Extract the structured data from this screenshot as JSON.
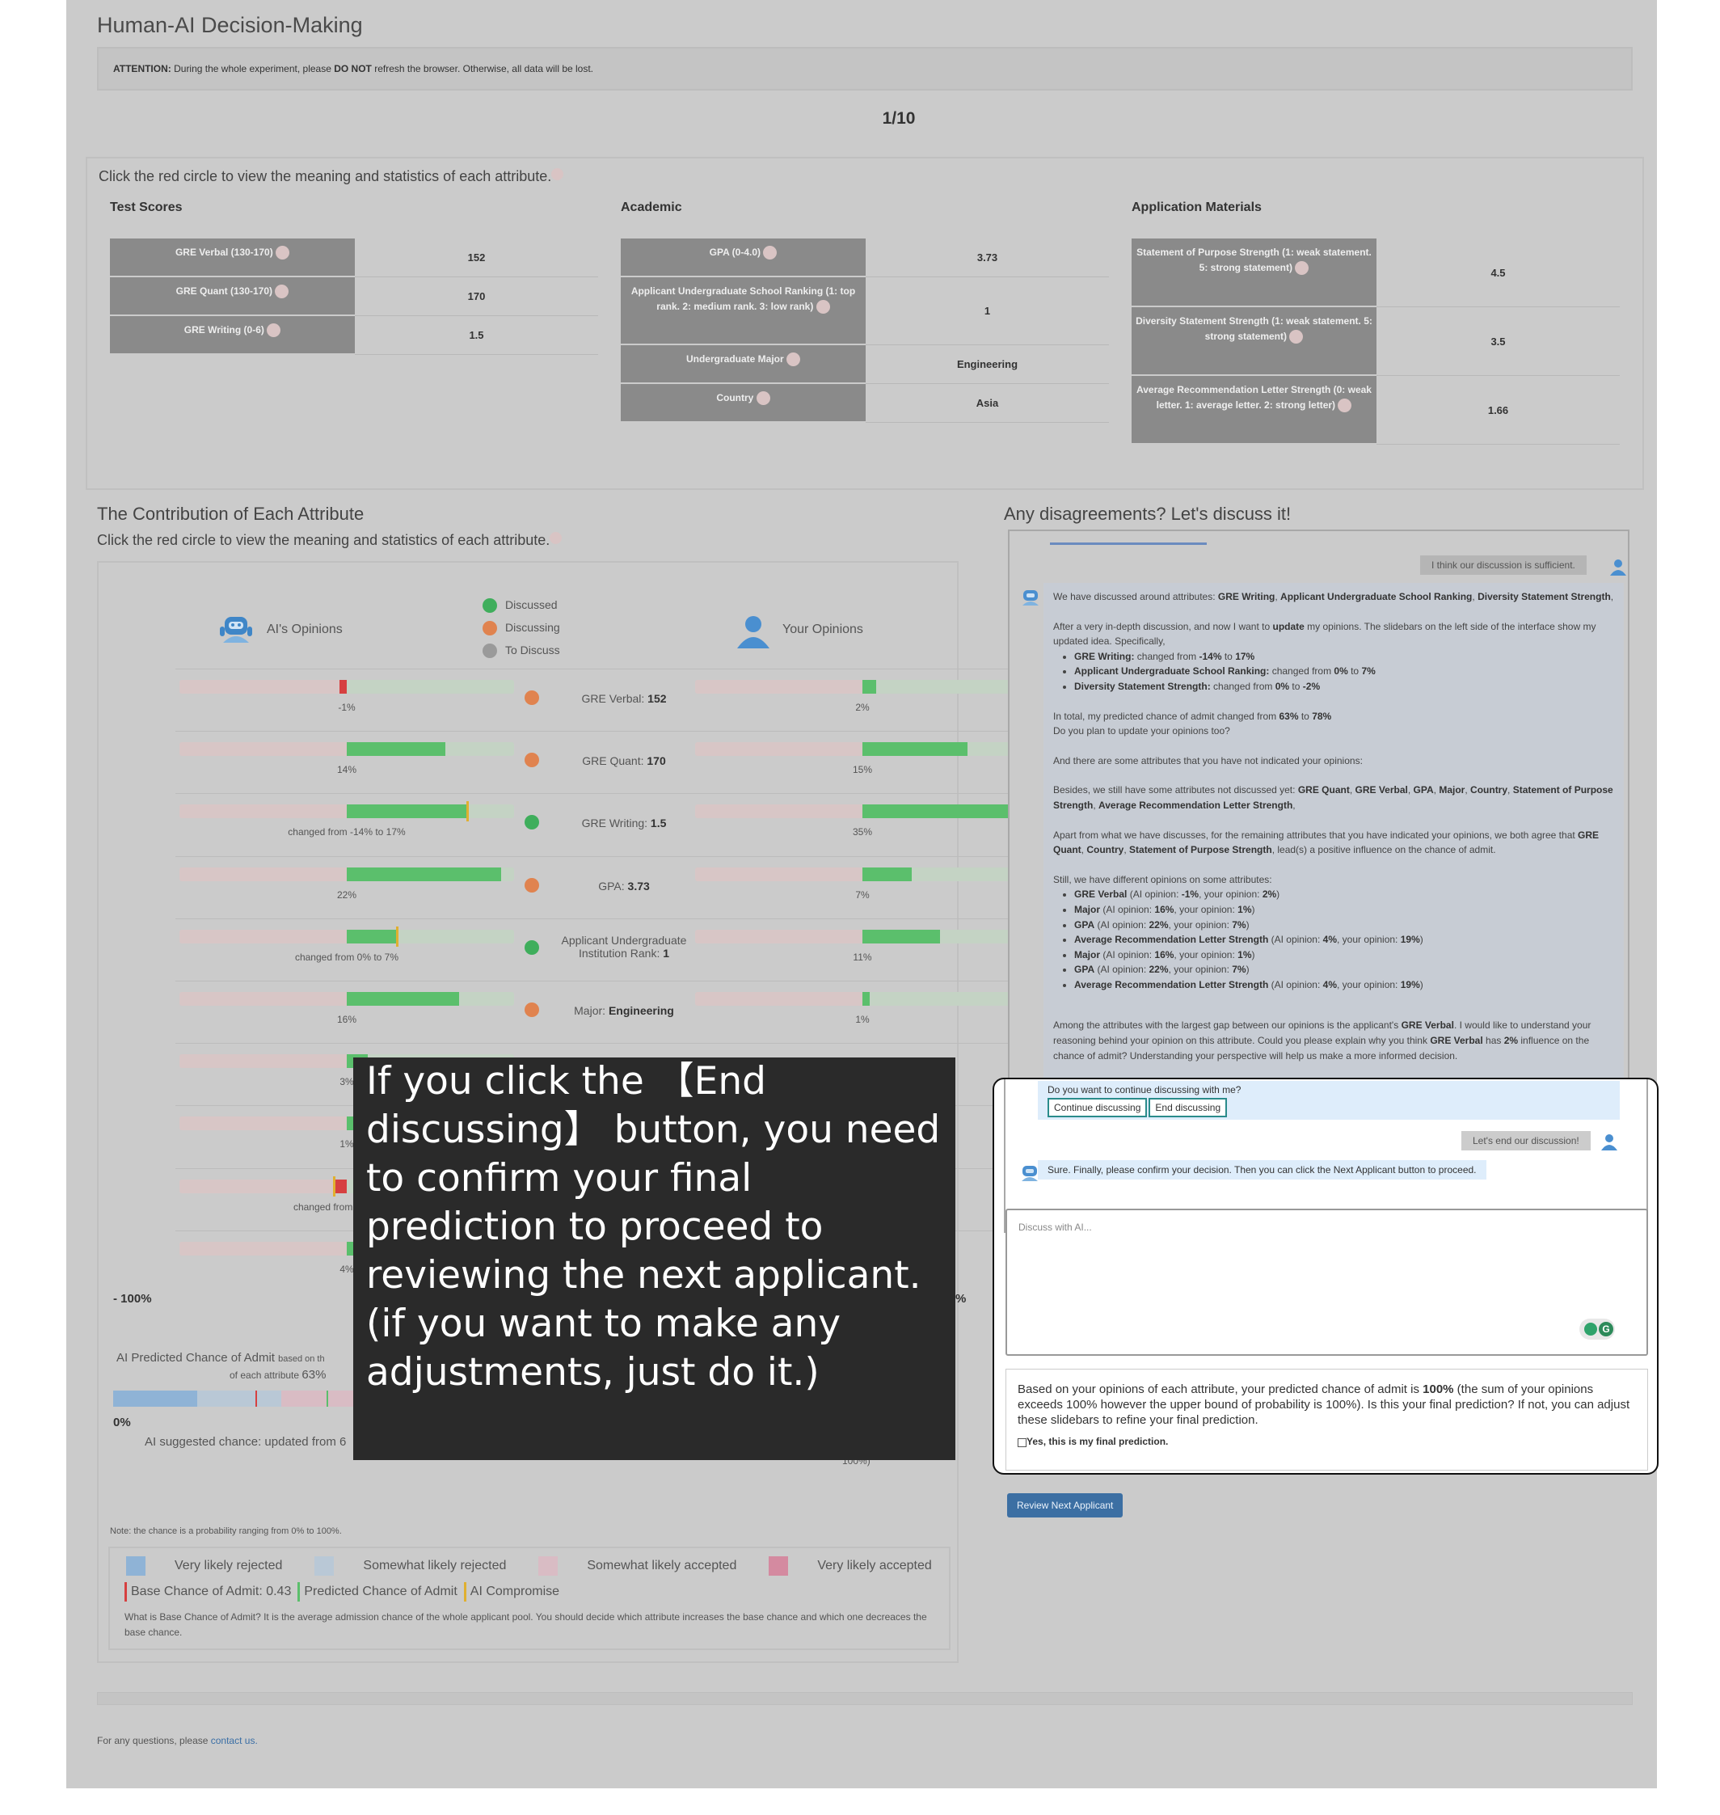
{
  "app_title": "Human-AI Decision-Making",
  "attention": {
    "label": "ATTENTION:",
    "text1": " During the whole experiment, please ",
    "emph": "DO NOT",
    "text2": " refresh the browser. Otherwise, all data will be lost."
  },
  "progress": "1/10",
  "attributes_info": "Click the red circle to view the meaning and statistics of each attribute.",
  "sections": {
    "test_scores": {
      "title": "Test Scores",
      "rows": [
        {
          "key": "GRE Verbal (130-170)",
          "value": "152"
        },
        {
          "key": "GRE Quant (130-170)",
          "value": "170"
        },
        {
          "key": "GRE Writing (0-6)",
          "value": "1.5"
        }
      ]
    },
    "academic": {
      "title": "Academic",
      "rows": [
        {
          "key": "GPA (0-4.0)",
          "value": "3.73"
        },
        {
          "key": "Applicant Undergraduate School Ranking (1: top rank. 2: medium rank. 3: low rank)",
          "value": "1"
        },
        {
          "key": "Undergraduate Major",
          "value": "Engineering"
        },
        {
          "key": "Country",
          "value": "Asia"
        }
      ]
    },
    "materials": {
      "title": "Application Materials",
      "rows": [
        {
          "key": "Statement of Purpose Strength (1: weak statement. 5: strong statement)",
          "value": "4.5"
        },
        {
          "key": "Diversity Statement Strength (1: weak statement. 5: strong statement)",
          "value": "3.5"
        },
        {
          "key": "Average Recommendation Letter Strength (0: weak letter. 1: average letter. 2: strong letter)",
          "value": "1.66"
        }
      ]
    }
  },
  "contribution": {
    "title": "The Contribution of Each Attribute",
    "info": "Click the red circle to view the meaning and statistics of each attribute.",
    "ai_opinions": "AI's Opinions",
    "your_opinions": "Your Opinions",
    "status_legend": [
      {
        "label": "Discussed",
        "color": "#3fae5c"
      },
      {
        "label": "Discussing",
        "color": "#e0834f"
      },
      {
        "label": "To Discuss",
        "color": "#9a9a9a"
      }
    ],
    "rows": [
      {
        "ai_text": "-1%",
        "ai_value": -1,
        "status": "discussing",
        "label": "GRE Verbal: ",
        "label_value": "152",
        "your_text": "2%",
        "your_value": 2
      },
      {
        "ai_text": "14%",
        "ai_value": 14,
        "status": "discussing",
        "label": "GRE Quant: ",
        "label_value": "170",
        "your_text": "15%",
        "your_value": 15
      },
      {
        "ai_text": "changed from -14% to 17%",
        "ai_value": 17,
        "status": "discussed",
        "label": "GRE Writing: ",
        "label_value": "1.5",
        "your_text": "35%",
        "your_value": 35
      },
      {
        "ai_text": "22%",
        "ai_value": 22,
        "status": "discussing",
        "label": "GPA: ",
        "label_value": "3.73",
        "your_text": "7%",
        "your_value": 7
      },
      {
        "ai_text": "changed from 0% to 7%",
        "ai_value": 7,
        "status": "discussed",
        "label": "Applicant Undergraduate Institution Rank: ",
        "label_value": "1",
        "your_text": "11%",
        "your_value": 11
      },
      {
        "ai_text": "16%",
        "ai_value": 16,
        "status": "discussing",
        "label": "Major: ",
        "label_value": "Engineering",
        "your_text": "1%",
        "your_value": 1
      },
      {
        "ai_text": "3%",
        "ai_value": 3
      },
      {
        "ai_text": "1%",
        "ai_value": 1
      },
      {
        "ai_text": "changed from 0% to -2%",
        "ai_value": -2
      },
      {
        "ai_text": "4%",
        "ai_value": 4
      }
    ],
    "minus_100": "- 100%",
    "plus_100_partial": "%",
    "ai_predicted_label": "AI Predicted Chance of Admit",
    "ai_predicted_sub1": "based on th",
    "ai_predicted_sub2": "of each attribute",
    "ai_predicted_value": "63%",
    "zero_pct": "0%",
    "right_pct_partial": "%",
    "ai_suggested": "AI suggested chance: updated from 6",
    "bottom_partial": "100%)",
    "note": "Note: the chance is a probability ranging from 0% to 100%.",
    "legend": [
      {
        "label": "Very likely rejected",
        "color": "#8fb3d6"
      },
      {
        "label": "Somewhat likely rejected",
        "color": "#b9c8d6"
      },
      {
        "label": "Somewhat likely accepted",
        "color": "#d9bcc4"
      },
      {
        "label": "Very likely accepted",
        "color": "#d48aa0"
      }
    ],
    "lines_legend": [
      {
        "label": "Base Chance of Admit: 0.43",
        "color": "#d64040"
      },
      {
        "label": "Predicted Chance of Admit",
        "color": "#5bbf6c"
      },
      {
        "label": "AI Compromise",
        "color": "#e0b030"
      }
    ],
    "base_explain": "What is Base Chance of Admit? It is the average admission chance of the whole applicant pool. You should decide which attribute increases the base chance and which one decreaces the base chance."
  },
  "chat": {
    "title": "Any disagreements? Let's discuss it!",
    "user_msg1": "I think our discussion is sufficient.",
    "ai_intro": {
      "t1": "We have discussed around attributes: ",
      "b1": "GRE Writing",
      "t2": ", ",
      "b2": "Applicant Undergraduate School Ranking",
      "t3": ", ",
      "b3": "Diversity Statement Strength",
      "t4": ","
    },
    "ai_update": {
      "t1": "After a very in-depth discussion, and now I want to ",
      "b1": "update",
      "t2": " my opinions. The slidebars on the left side of the interface show my updated idea. Specifically,"
    },
    "changes": [
      {
        "name": "GRE Writing:",
        "text": " changed from ",
        "from": "-14%",
        "to_word": " to ",
        "to": "17%"
      },
      {
        "name": "Applicant Undergraduate School Ranking:",
        "text": " changed from ",
        "from": "0%",
        "to_word": " to ",
        "to": "7%"
      },
      {
        "name": "Diversity Statement Strength:",
        "text": " changed from ",
        "from": "0%",
        "to_word": " to ",
        "to": "-2%"
      }
    ],
    "total": {
      "t1": "In total, my predicted chance of admit changed from ",
      "b1": "63%",
      "t2": " to ",
      "b2": "78%"
    },
    "ask_update": "Do you plan to update your opinions too?",
    "not_indicated": "And there are some attributes that you have not indicated your opinions:",
    "not_discussed": {
      "t1": "Besides, we still have some attributes not discussed yet: ",
      "items": [
        "GRE Quant",
        "GRE Verbal",
        "GPA",
        "Major",
        "Country",
        "Statement of Purpose Strength",
        "Average Recommendation Letter Strength"
      ],
      "end": ","
    },
    "agree": {
      "t1": "Apart from what we have discusses, for the remaining attributes that you have indicated your opinions, we both agree that ",
      "b1": "GRE Quant",
      "t2": ", ",
      "b2": "Country",
      "t3": ", ",
      "b3": "Statement of Purpose Strength",
      "t4": ", lead(s) a positive influence on the chance of admit."
    },
    "different": "Still, we have different opinions on some attributes:",
    "diffs": [
      {
        "name": "GRE Verbal",
        "ai": "-1%",
        "you": "2%"
      },
      {
        "name": "Major",
        "ai": "16%",
        "you": "1%"
      },
      {
        "name": "GPA",
        "ai": "22%",
        "you": "7%"
      },
      {
        "name": "Average Recommendation Letter Strength",
        "ai": "4%",
        "you": "19%"
      },
      {
        "name": "Major",
        "ai": "16%",
        "you": "1%"
      },
      {
        "name": "GPA",
        "ai": "22%",
        "you": "7%"
      },
      {
        "name": "Average Recommendation Letter Strength",
        "ai": "4%",
        "you": "19%"
      }
    ],
    "diff_ai_label": " (AI opinion: ",
    "diff_you_label": ", your opinion: ",
    "diff_end": ")",
    "gap": {
      "t1": "Among the attributes with the largest gap between our opinions is the applicant's ",
      "b1": "GRE Verbal",
      "t2": ". I would like to understand your reasoning behind your opinion on this attribute. Could you please explain why you think ",
      "b2": "GRE Verbal",
      "t3": " has ",
      "b3": "2%",
      "t4": " influence on the chance of admit? Understanding your perspective will help us make a more informed decision."
    },
    "continue_q": "Do you want to continue discussing with me?",
    "continue_btn": "Continue discussing",
    "end_btn": "End discussing",
    "user_msg2": "Let's end our discussion!",
    "ai_final": "Sure. Finally, please confirm your decision. Then you can click the Next Applicant button to proceed.",
    "input_placeholder": "Discuss with AI..."
  },
  "final": {
    "t1": "Based on your opinions of each attribute, your predicted chance of admit is ",
    "b1": "100%",
    "t2": " (the sum of your opinions exceeds 100% however the upper bound of probability is 100%). Is this your final prediction? If not, you can adjust these slidebars to refine your final prediction.",
    "checkbox_label": "Yes, this is my final prediction."
  },
  "review_btn": "Review Next Applicant",
  "footer": {
    "text": "For any questions, please ",
    "link": "contact us."
  },
  "overlay_text": "If you click the 【End discussing】 button, you need to confirm your final prediction to proceed to reviewing the next applicant. (if you want to make any adjustments, just do it.)"
}
